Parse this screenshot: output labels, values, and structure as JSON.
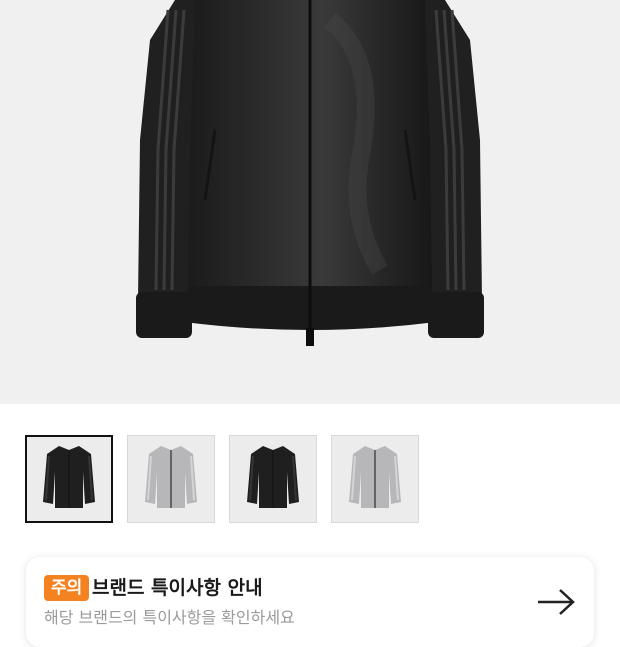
{
  "product": {
    "main_image": "black-track-jacket",
    "thumbnails": [
      {
        "name": "black-track-jacket",
        "color": "#1f1f1f",
        "stripe": "#353535"
      },
      {
        "name": "silver-track-jacket",
        "color": "#b7b7b9",
        "stripe": "#d4d4d6"
      },
      {
        "name": "black-track-jacket",
        "color": "#1f1f1f",
        "stripe": "#353535"
      },
      {
        "name": "silver-track-jacket",
        "color": "#b7b7b9",
        "stripe": "#d4d4d6"
      }
    ],
    "selected_thumbnail": 0
  },
  "notice": {
    "badge": "주의",
    "title": "브랜드 특이사항 안내",
    "subtitle": "해당 브랜드의 특이사항을 확인하세요",
    "arrow_icon": "arrow-right-icon",
    "badge_color": "#f58220"
  }
}
